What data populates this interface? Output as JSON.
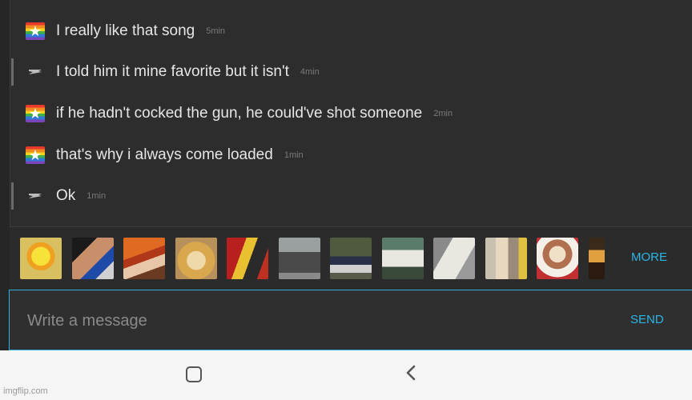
{
  "messages": [
    {
      "avatar": "rainbow-star-flag-icon",
      "text": "I really like that song",
      "time": "5min",
      "own": false
    },
    {
      "avatar": "gray-emblem-icon",
      "text": "I told him it mine favorite but it isn't",
      "time": "4min",
      "own": true
    },
    {
      "avatar": "rainbow-star-flag-icon",
      "text": "if he hadn't cocked the gun, he could've shot someone",
      "time": "2min",
      "own": false
    },
    {
      "avatar": "rainbow-star-flag-icon",
      "text": "that's why i always come loaded",
      "time": "1min",
      "own": false
    },
    {
      "avatar": "gray-emblem-icon",
      "text": "Ok",
      "time": "1min",
      "own": true
    }
  ],
  "meme_strip": {
    "thumbnails": [
      "spongebob-imagination-meme",
      "hand-pressing-button-meme",
      "disaster-girl-meme",
      "doge-meme",
      "batman-slapping-robin-meme",
      "bernie-sitting-meme",
      "change-my-mind-meme",
      "waiting-skeleton-meme",
      "unsettled-tom-meme",
      "is-this-a-pigeon-meme",
      "buddy-christ-meme",
      "partial-thumbnail"
    ],
    "more_label": "MORE"
  },
  "composer": {
    "placeholder": "Write a message",
    "send_label": "SEND"
  },
  "nav": {
    "home": "home-icon",
    "back": "back-chevron-icon"
  },
  "watermark": "imgflip.com",
  "colors": {
    "accent": "#2bb5e6",
    "background": "#2d2d2d",
    "text": "#e6e6e6",
    "timestamp": "#7a7a7a"
  }
}
